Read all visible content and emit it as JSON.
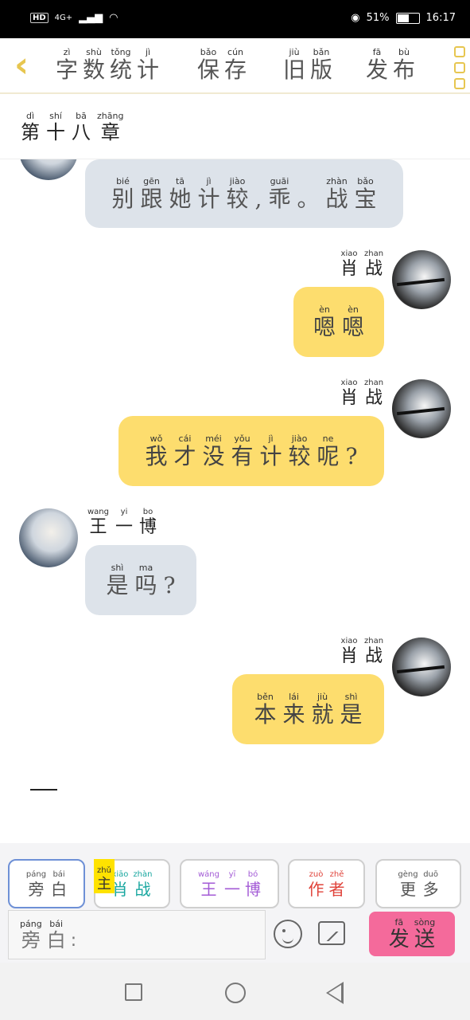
{
  "status_bar": {
    "hd": "HD",
    "network": "4G+",
    "battery": "51%",
    "time": "16:17"
  },
  "toolbar": {
    "back_icon": "chevron-left-icon",
    "items": [
      {
        "chars": [
          [
            "zì",
            "字"
          ],
          [
            "shù",
            "数"
          ],
          [
            "tǒng",
            "统"
          ],
          [
            "jì",
            "计"
          ]
        ]
      },
      {
        "chars": [
          [
            "bǎo",
            "保"
          ],
          [
            "cún",
            "存"
          ]
        ]
      },
      {
        "chars": [
          [
            "jiù",
            "旧"
          ],
          [
            "bǎn",
            "版"
          ]
        ]
      },
      {
        "chars": [
          [
            "fā",
            "发"
          ],
          [
            "bù",
            "布"
          ]
        ]
      }
    ],
    "menu_icon": "more-icon",
    "accent": "#e7c650"
  },
  "chapter": {
    "chars": [
      [
        "dì",
        "第"
      ],
      [
        "shí",
        "十"
      ],
      [
        "bā",
        "八"
      ],
      [
        "zhāng",
        "章"
      ]
    ]
  },
  "messages": [
    {
      "side": "left",
      "bubble": {
        "chars": [
          [
            "bié",
            "别"
          ],
          [
            "gēn",
            "跟"
          ],
          [
            "tā",
            "她"
          ],
          [
            "jì",
            "计"
          ],
          [
            "jiào",
            "较"
          ],
          [
            "",
            ","
          ],
          [
            "guāi",
            "乖"
          ],
          [
            "",
            "。"
          ],
          [
            "zhàn",
            "战"
          ],
          [
            "bǎo",
            "宝"
          ]
        ]
      }
    },
    {
      "side": "right",
      "name": [
        [
          "xiao",
          "肖"
        ],
        [
          "zhan",
          "战"
        ]
      ],
      "bubble": {
        "chars": [
          [
            "èn",
            "嗯"
          ],
          [
            "èn",
            "嗯"
          ]
        ]
      }
    },
    {
      "side": "right",
      "name": [
        [
          "xiao",
          "肖"
        ],
        [
          "zhan",
          "战"
        ]
      ],
      "bubble": {
        "chars": [
          [
            "wǒ",
            "我"
          ],
          [
            "cái",
            "才"
          ],
          [
            "méi",
            "没"
          ],
          [
            "yǒu",
            "有"
          ],
          [
            "jì",
            "计"
          ],
          [
            "jiào",
            "较"
          ],
          [
            "ne",
            "呢"
          ],
          [
            "",
            "?"
          ]
        ]
      }
    },
    {
      "side": "left",
      "name": [
        [
          "wang",
          "王"
        ],
        [
          "yi",
          "一"
        ],
        [
          "bo",
          "博"
        ]
      ],
      "bubble": {
        "chars": [
          [
            "shì",
            "是"
          ],
          [
            "ma",
            "吗"
          ],
          [
            "",
            "?"
          ]
        ]
      }
    },
    {
      "side": "right",
      "name": [
        [
          "xiao",
          "肖"
        ],
        [
          "zhan",
          "战"
        ]
      ],
      "bubble": {
        "chars": [
          [
            "běn",
            "本"
          ],
          [
            "lái",
            "来"
          ],
          [
            "jiù",
            "就"
          ],
          [
            "shì",
            "是"
          ]
        ]
      }
    }
  ],
  "role_tabs": [
    {
      "id": "narration",
      "chars": [
        [
          "páng",
          "旁"
        ],
        [
          "bái",
          "白"
        ]
      ],
      "color": "#555555",
      "selected": true
    },
    {
      "id": "xiao-zhan",
      "tag": [
        [
          "zhǔ",
          "主"
        ]
      ],
      "chars": [
        [
          "xiāo",
          "肖"
        ],
        [
          "zhàn",
          "战"
        ]
      ],
      "color": "#19a7a0"
    },
    {
      "id": "wang-yibo",
      "chars": [
        [
          "wáng",
          "王"
        ],
        [
          "yī",
          "一"
        ],
        [
          "bó",
          "博"
        ]
      ],
      "color": "#a35bd6"
    },
    {
      "id": "author",
      "chars": [
        [
          "zuò",
          "作"
        ],
        [
          "zhě",
          "者"
        ]
      ],
      "color": "#e0433a"
    },
    {
      "id": "more",
      "chars": [
        [
          "gèng",
          "更"
        ],
        [
          "duō",
          "多"
        ]
      ],
      "color": "#555555"
    }
  ],
  "input": {
    "prefix": [
      [
        "páng",
        "旁"
      ],
      [
        "bái",
        "白"
      ]
    ],
    "colon": ":"
  },
  "send": {
    "chars": [
      [
        "fā",
        "发"
      ],
      [
        "sòng",
        "送"
      ]
    ],
    "color": "#f46a9b"
  },
  "icons": {
    "emoji": "emoji-icon",
    "image": "image-icon"
  },
  "colors": {
    "gray_bubble": "#dde3ea",
    "yellow_bubble": "#fddd6e"
  }
}
